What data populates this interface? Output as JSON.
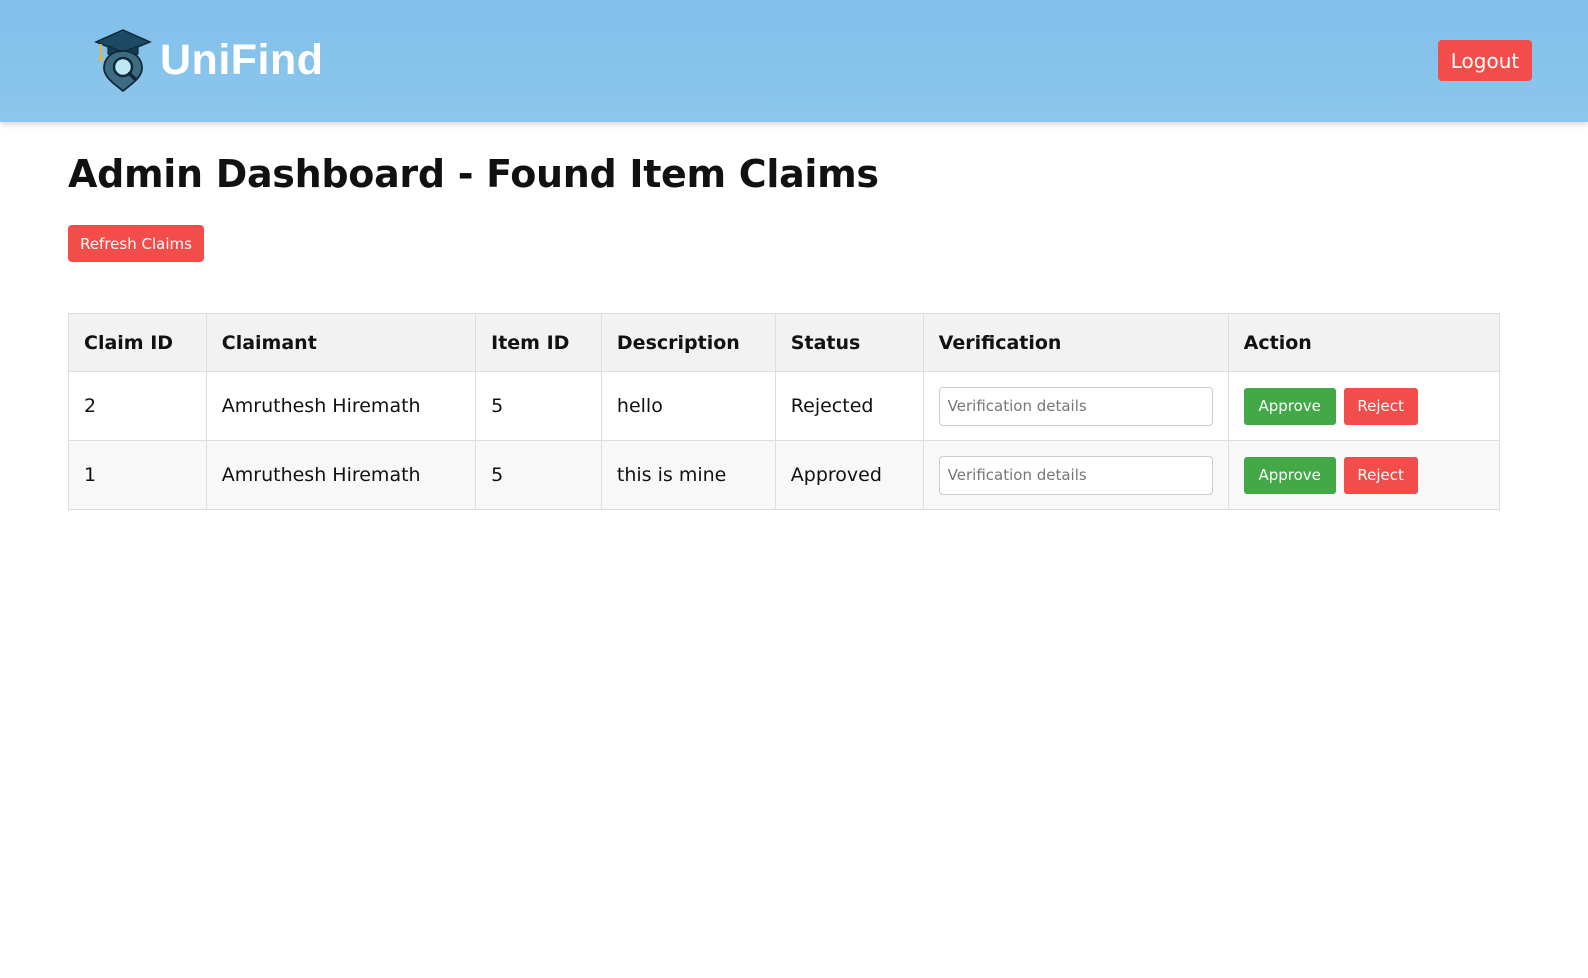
{
  "header": {
    "brand_name": "UniFind",
    "logout_label": "Logout",
    "logo_icon": "graduation-cap-search-pin-icon"
  },
  "main": {
    "title": "Admin Dashboard - Found Item Claims",
    "refresh_label": "Refresh Claims"
  },
  "table": {
    "columns": [
      "Claim ID",
      "Claimant",
      "Item ID",
      "Description",
      "Status",
      "Verification",
      "Action"
    ],
    "rows": [
      {
        "claim_id": "2",
        "claimant": "Amruthesh Hiremath",
        "item_id": "5",
        "description": "hello",
        "status": "Rejected",
        "verification_value": "",
        "verification_placeholder": "Verification details",
        "approve_label": "Approve",
        "reject_label": "Reject"
      },
      {
        "claim_id": "1",
        "claimant": "Amruthesh Hiremath",
        "item_id": "5",
        "description": "this is mine",
        "status": "Approved",
        "verification_value": "",
        "verification_placeholder": "Verification details",
        "approve_label": "Approve",
        "reject_label": "Reject"
      }
    ]
  },
  "colors": {
    "header_bg": "#86c2ea",
    "danger": "#f24d4a",
    "success": "#43a947",
    "table_header_bg": "#f2f2f2",
    "border": "#dddddd"
  }
}
